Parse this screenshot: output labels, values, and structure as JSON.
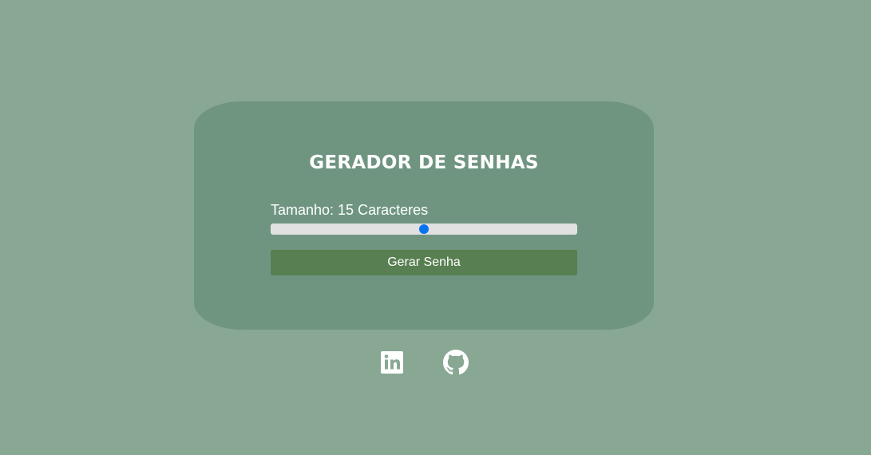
{
  "app": {
    "title": "GERADOR DE SENHAS"
  },
  "generator": {
    "size_label": "Tamanho: 15 Caracteres",
    "slider_value_fraction": 0.5,
    "generate_button_label": "Gerar Senha"
  },
  "social": [
    {
      "name": "LinkedIn",
      "icon": "linkedin-icon"
    },
    {
      "name": "GitHub",
      "icon": "github-icon"
    }
  ],
  "colors": {
    "background": "#88a893",
    "card": "#6f9581",
    "button": "#587f51",
    "slider_track": "#e1e1e1",
    "slider_thumb": "#0a74f0",
    "text": "#ffffff"
  }
}
